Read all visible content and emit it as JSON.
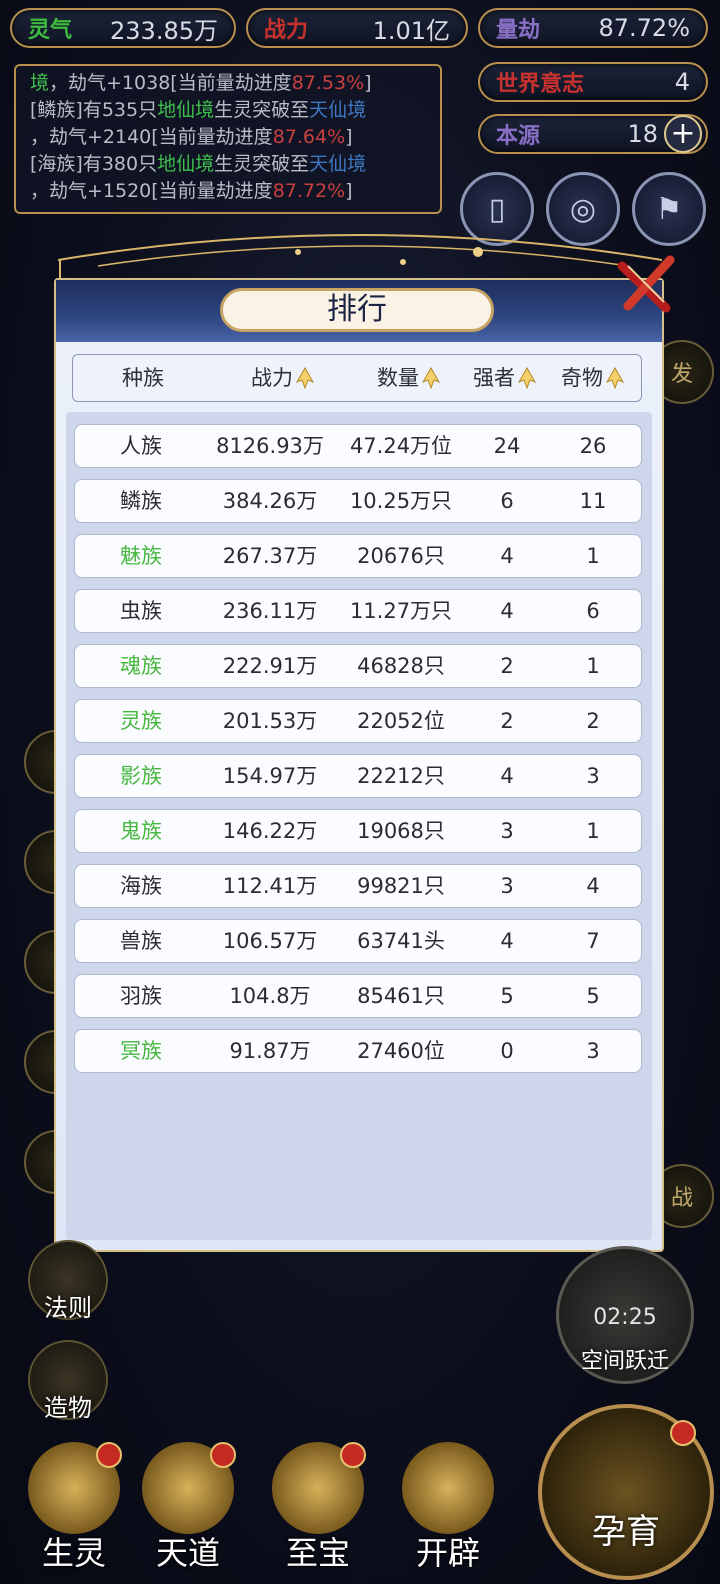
{
  "resources": {
    "lingqi": {
      "label": "灵气",
      "value": "233.85万",
      "label_color": "#3dbd3d"
    },
    "zhanli": {
      "label": "战力",
      "value": "1.01亿",
      "label_color": "#c8322e"
    },
    "liangjie": {
      "label": "量劫",
      "value": "87.72%",
      "label_color": "#8a6fc6"
    },
    "shijie": {
      "label": "世界意志",
      "value": "4",
      "label_color": "#c8322e"
    },
    "benyuan": {
      "label": "本源",
      "value": "18",
      "label_color": "#8a6fc6"
    }
  },
  "log": {
    "line1": {
      "a": "境",
      "b": "，劫气+1038[当前量劫进度",
      "c": "87.53%",
      "d": "]"
    },
    "line2": {
      "a": "[鳞族]有535只",
      "b": "地仙境",
      "c": "生灵突破至",
      "d": "天仙境"
    },
    "line3": {
      "a": "，劫气+2140[当前量劫进度",
      "b": "87.64%",
      "c": "]"
    },
    "line4": {
      "a": "[海族]有380只",
      "b": "地仙境",
      "c": "生灵突破至",
      "d": "天仙境"
    },
    "line5": {
      "a": "，劫气+1520[当前量劫进度",
      "b": "87.72%",
      "c": "]"
    }
  },
  "side_labels": {
    "right_fa": "发",
    "right_zhan": "战"
  },
  "panel": {
    "title": "排行",
    "headers": {
      "race": "种族",
      "power": "战力",
      "count": "数量",
      "strong": "强者",
      "treasure": "奇物"
    },
    "rows": [
      {
        "race": "人族",
        "power": "8126.93万",
        "count": "47.24万位",
        "strong": "24",
        "treasure": "26",
        "green": false
      },
      {
        "race": "鳞族",
        "power": "384.26万",
        "count": "10.25万只",
        "strong": "6",
        "treasure": "11",
        "green": false
      },
      {
        "race": "魅族",
        "power": "267.37万",
        "count": "20676只",
        "strong": "4",
        "treasure": "1",
        "green": true
      },
      {
        "race": "虫族",
        "power": "236.11万",
        "count": "11.27万只",
        "strong": "4",
        "treasure": "6",
        "green": false
      },
      {
        "race": "魂族",
        "power": "222.91万",
        "count": "46828只",
        "strong": "2",
        "treasure": "1",
        "green": true
      },
      {
        "race": "灵族",
        "power": "201.53万",
        "count": "22052位",
        "strong": "2",
        "treasure": "2",
        "green": true
      },
      {
        "race": "影族",
        "power": "154.97万",
        "count": "22212只",
        "strong": "4",
        "treasure": "3",
        "green": true
      },
      {
        "race": "鬼族",
        "power": "146.22万",
        "count": "19068只",
        "strong": "3",
        "treasure": "1",
        "green": true
      },
      {
        "race": "海族",
        "power": "112.41万",
        "count": "99821只",
        "strong": "3",
        "treasure": "4",
        "green": false
      },
      {
        "race": "兽族",
        "power": "106.57万",
        "count": "63741头",
        "strong": "4",
        "treasure": "7",
        "green": false
      },
      {
        "race": "羽族",
        "power": "104.8万",
        "count": "85461只",
        "strong": "5",
        "treasure": "5",
        "green": false
      },
      {
        "race": "冥族",
        "power": "91.87万",
        "count": "27460位",
        "strong": "0",
        "treasure": "3",
        "green": true
      }
    ]
  },
  "left_buttons": {
    "fazhe": "法则",
    "zaowu": "造物"
  },
  "timer": {
    "time": "02:25",
    "label": "空间跃迁"
  },
  "bottom_nav": {
    "shengling": "生灵",
    "tiandao": "天道",
    "zhibao": "至宝",
    "kaipi": "开辟",
    "yunyu": "孕育"
  },
  "colors": {
    "accent_gold": "#b88f4e",
    "green_text": "#46b73f",
    "panel_bg": "#e6ecf8"
  }
}
